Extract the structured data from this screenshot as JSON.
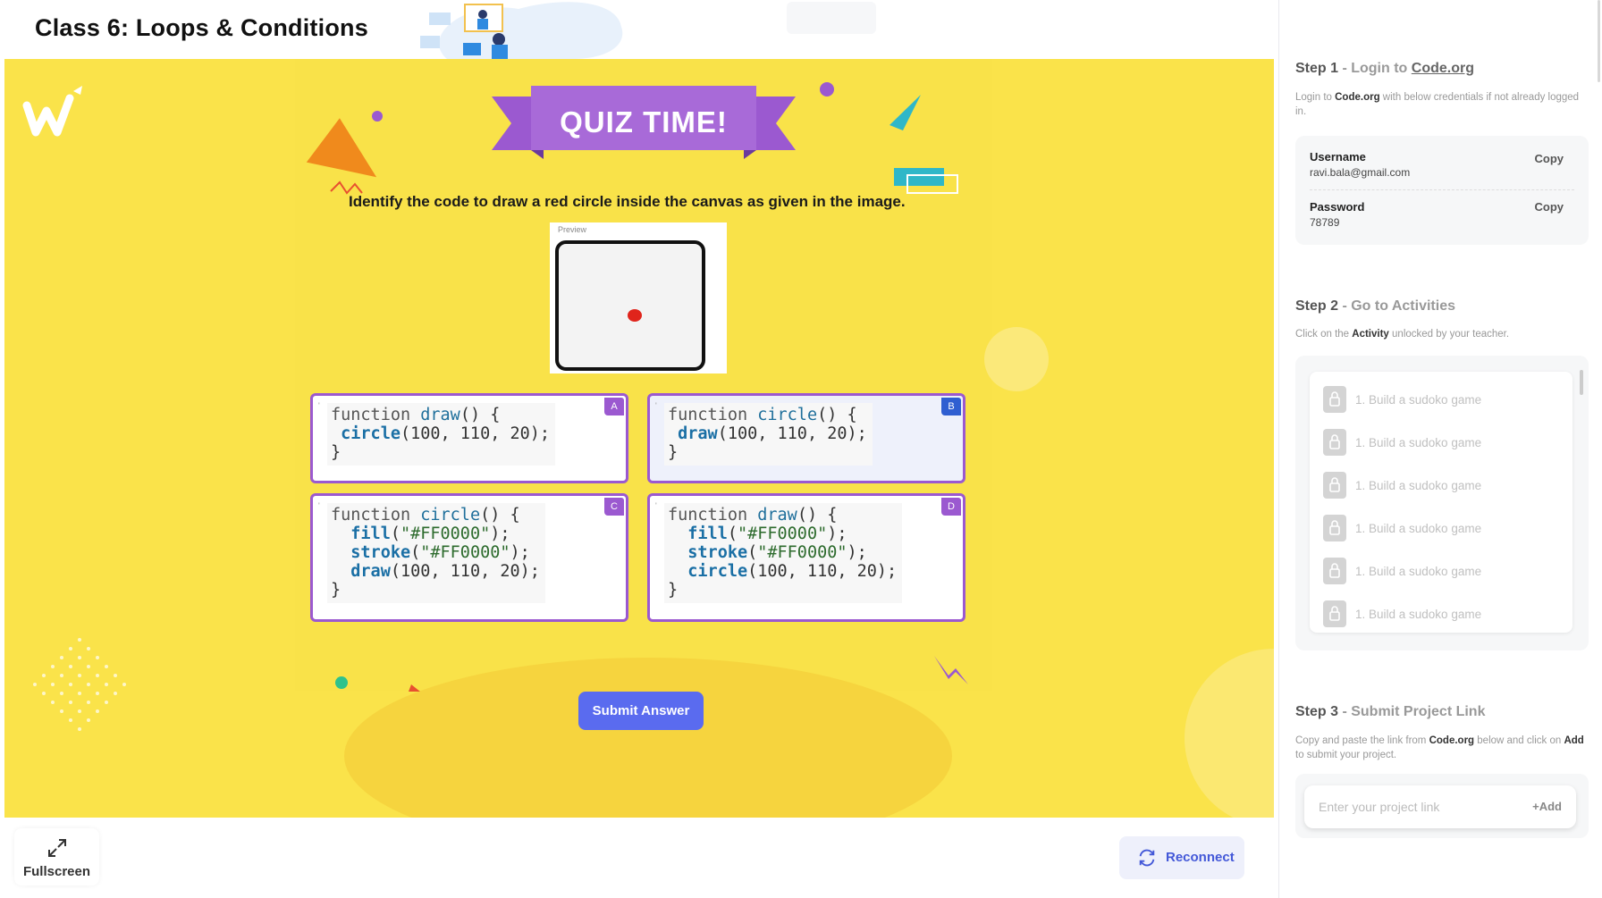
{
  "header": {
    "class_title": "Class 6: Loops & Conditions"
  },
  "quiz": {
    "banner": "QUIZ TIME!",
    "question": "Identify the code to draw a red circle inside the canvas as given in the image.",
    "preview_label": "Preview",
    "options": [
      {
        "letter": "A",
        "lines": [
          "function draw() {",
          " circle(100, 110, 20);",
          "}"
        ]
      },
      {
        "letter": "B",
        "lines": [
          "function circle() {",
          " draw(100, 110, 20);",
          "}"
        ]
      },
      {
        "letter": "C",
        "lines": [
          "function circle() {",
          "  fill(\"#FF0000\");",
          "  stroke(\"#FF0000\");",
          "  draw(100, 110, 20);",
          "}"
        ]
      },
      {
        "letter": "D",
        "lines": [
          "function draw() {",
          "  fill(\"#FF0000\");",
          "  stroke(\"#FF0000\");",
          "  circle(100, 110, 20);",
          "}"
        ]
      }
    ],
    "selected": "B",
    "submit_label": "Submit Answer"
  },
  "controls": {
    "fullscreen_label": "Fullscreen",
    "reconnect_label": "Reconnect"
  },
  "sidebar": {
    "step1": {
      "num": "Step 1",
      "sep": " - Login to ",
      "site": "Code.org",
      "desc_pre": "Login to ",
      "desc_site": "Code.org",
      "desc_post": " with below credentials if not already logged in.",
      "username_label": "Username",
      "username_value": "ravi.bala@gmail.com",
      "password_label": "Password",
      "password_value": "78789",
      "copy_label": "Copy"
    },
    "step2": {
      "num": "Step 2",
      "title": " - Go to Activities",
      "desc_pre": "Click on the ",
      "desc_bold": "Activity",
      "desc_post": " unlocked by your teacher.",
      "activities": [
        "1. Build a sudoko game",
        "1. Build a sudoko game",
        "1. Build a sudoko game",
        "1. Build a sudoko game",
        "1. Build a sudoko game",
        "1. Build a sudoko game"
      ]
    },
    "step3": {
      "num": "Step 3",
      "title": " - Submit Project Link",
      "desc_pre": "Copy and paste the link from ",
      "desc_site": "Code.org",
      "desc_mid": " below and click on ",
      "desc_add": "Add",
      "desc_post": " to submit your project.",
      "input_placeholder": "Enter your project link",
      "add_label": "+Add"
    }
  },
  "colors": {
    "stage_bg": "#fae34a",
    "option_border": "#9b59d0",
    "selected_badge": "#2f5fd1",
    "submit_bg": "#5a6bef",
    "dot": "#e0241b"
  }
}
